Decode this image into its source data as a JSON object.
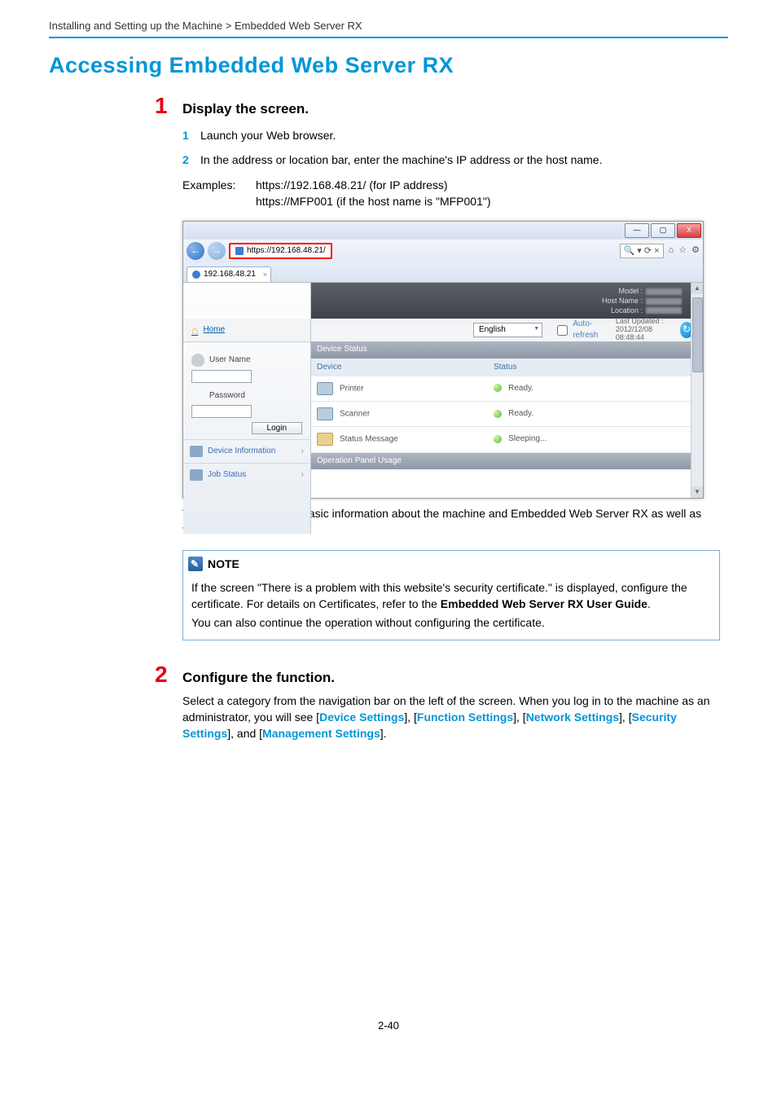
{
  "breadcrumb": "Installing and Setting up the Machine > Embedded Web Server RX",
  "title": "Accessing Embedded Web Server RX",
  "step1": {
    "num": "1",
    "heading": "Display the screen.",
    "items": {
      "1": {
        "num": "1",
        "text": "Launch your Web browser."
      },
      "2": {
        "num": "2",
        "text": "In the address or location bar, enter the machine's IP address or the host name."
      }
    },
    "examples_label": "Examples:",
    "examples_l1": "https://192.168.48.21/ (for IP address)",
    "examples_l2": "https://MFP001 (if the host name is \"MFP001\")",
    "after_shot": "The web page displays basic information about the machine and Embedded Web Server RX as well as their current status."
  },
  "screenshot": {
    "win": {
      "min": "—",
      "max": "▢",
      "close": "X"
    },
    "url": "https://192.168.48.21/",
    "search_glyph": "🔍",
    "refresh_glyph": "⟳",
    "stop_glyph": "×",
    "home_glyph": "⌂",
    "star_glyph": "☆",
    "gear_glyph": "⚙",
    "tab_label": "192.168.48.21",
    "banner": {
      "model": "Model :",
      "host": "Host Name :",
      "loc": "Location :"
    },
    "subbar": {
      "lang": "English",
      "auto": "Auto-refresh",
      "upd_label": "Last Updated :",
      "upd_time": "2012/12/08 08:48:44"
    },
    "side": {
      "home": "Home",
      "user": "User Name",
      "pass": "Password",
      "login": "Login",
      "devinfo": "Device Information",
      "jobstatus": "Job Status"
    },
    "main": {
      "sec_devstatus": "Device Status",
      "col_device": "Device",
      "col_status": "Status",
      "rows": {
        "printer": {
          "name": "Printer",
          "status": "Ready."
        },
        "scanner": {
          "name": "Scanner",
          "status": "Ready."
        },
        "statmsg": {
          "name": "Status Message",
          "status": "Sleeping..."
        }
      },
      "sec_panel": "Operation Panel Usage"
    }
  },
  "note": {
    "label": "NOTE",
    "p1a": "If the screen \"There is a problem with this website's security certificate.\" is displayed, configure the certificate. For details on Certificates, refer to the ",
    "p1b": "Embedded Web Server RX User Guide",
    "p1c": ".",
    "p2": "You can also continue the operation without configuring the certificate."
  },
  "step2": {
    "num": "2",
    "heading": "Configure the function.",
    "text_a": "Select a category from the navigation bar on the left of the screen. When you log in to the machine as an administrator, you will see [",
    "links": {
      "dev": "Device Settings",
      "func": "Function Settings",
      "net": "Network Settings",
      "sec": "Security Settings",
      "mgmt": "Management Settings"
    },
    "sep1": "], [",
    "sep2": "], [",
    "sep3": "], [",
    "sep4": "], and [",
    "text_b": "]."
  },
  "page_num": "2-40"
}
